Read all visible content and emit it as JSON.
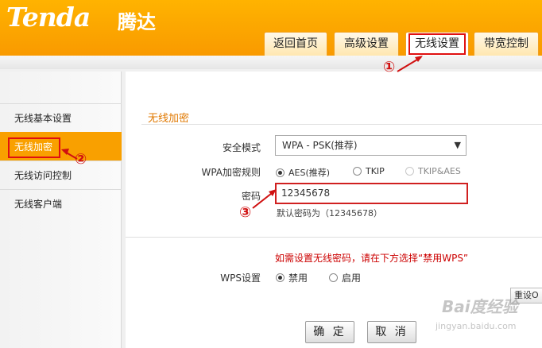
{
  "brand": {
    "logo": "Tenda",
    "logo_cn": "腾达"
  },
  "nav": {
    "tabs": [
      "返回首页",
      "高级设置",
      "无线设置",
      "带宽控制"
    ],
    "active": 2
  },
  "sidebar": {
    "items": [
      "无线基本设置",
      "无线加密",
      "无线访问控制",
      "无线客户端"
    ],
    "active": 1
  },
  "section": {
    "title": "无线加密"
  },
  "form": {
    "security_mode_label": "安全模式",
    "security_mode_value": "WPA - PSK(推荐)",
    "cipher_label": "WPA加密规则",
    "cipher_options": [
      "AES(推荐)",
      "TKIP",
      "TKIP&AES"
    ],
    "cipher_selected": 0,
    "password_label": "密码",
    "password_value": "12345678",
    "default_hint": "默认密码为（12345678）",
    "wps_warning": "如需设置无线密码，请在下方选择“禁用WPS”",
    "wps_label": "WPS设置",
    "wps_options": [
      "禁用",
      "启用"
    ],
    "wps_selected": 0,
    "reset_button": "重设O"
  },
  "buttons": {
    "ok": "确 定",
    "cancel": "取 消"
  },
  "annotations": {
    "one": "①",
    "two": "②",
    "three": "③"
  },
  "watermark": {
    "main": "Bai度经验",
    "url": "jingyan.baidu.com"
  },
  "colors": {
    "accent": "#f9a000",
    "highlight_red": "#e01010",
    "warning_red": "#cc0000",
    "section_title": "#e07800"
  }
}
